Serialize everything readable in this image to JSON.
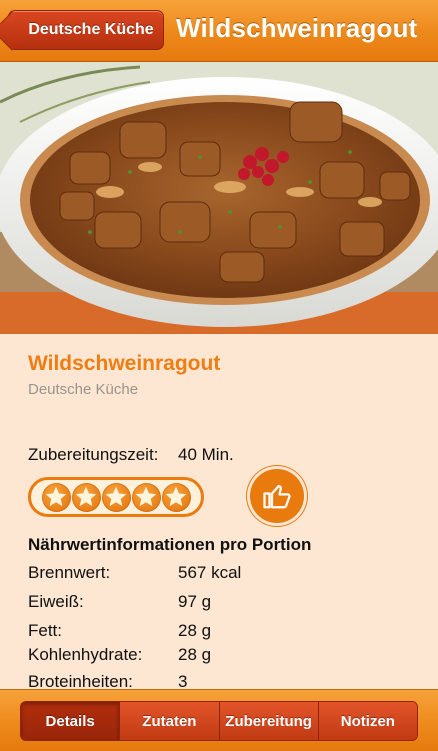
{
  "navbar": {
    "back_label": "Deutsche Küche",
    "title": "Wildschweinragout"
  },
  "photo": {
    "icon": "dish-photo"
  },
  "recipe": {
    "title": "Wildschweinragout",
    "category": "Deutsche Küche",
    "prep_label": "Zubereitungszeit:",
    "prep_value": "40 Min.",
    "rating": 5
  },
  "nutrition": {
    "heading": "Nährwertinformationen pro Portion",
    "rows": [
      {
        "label": "Brennwert:",
        "value": "567 kcal"
      },
      {
        "label": "Eiweiß:",
        "value": "97 g"
      },
      {
        "label": "Fett:",
        "value": "28 g"
      },
      {
        "label": "Kohlenhydrate:",
        "value": "28 g"
      },
      {
        "label": "Broteinheiten:",
        "value": "3"
      }
    ]
  },
  "tabs": [
    {
      "label": "Details",
      "active": true
    },
    {
      "label": "Zutaten",
      "active": false
    },
    {
      "label": "Zubereitung",
      "active": false
    },
    {
      "label": "Notizen",
      "active": false
    }
  ],
  "colors": {
    "accent": "#ee7d12",
    "background": "#fde6d2",
    "button": "#c13a13"
  }
}
